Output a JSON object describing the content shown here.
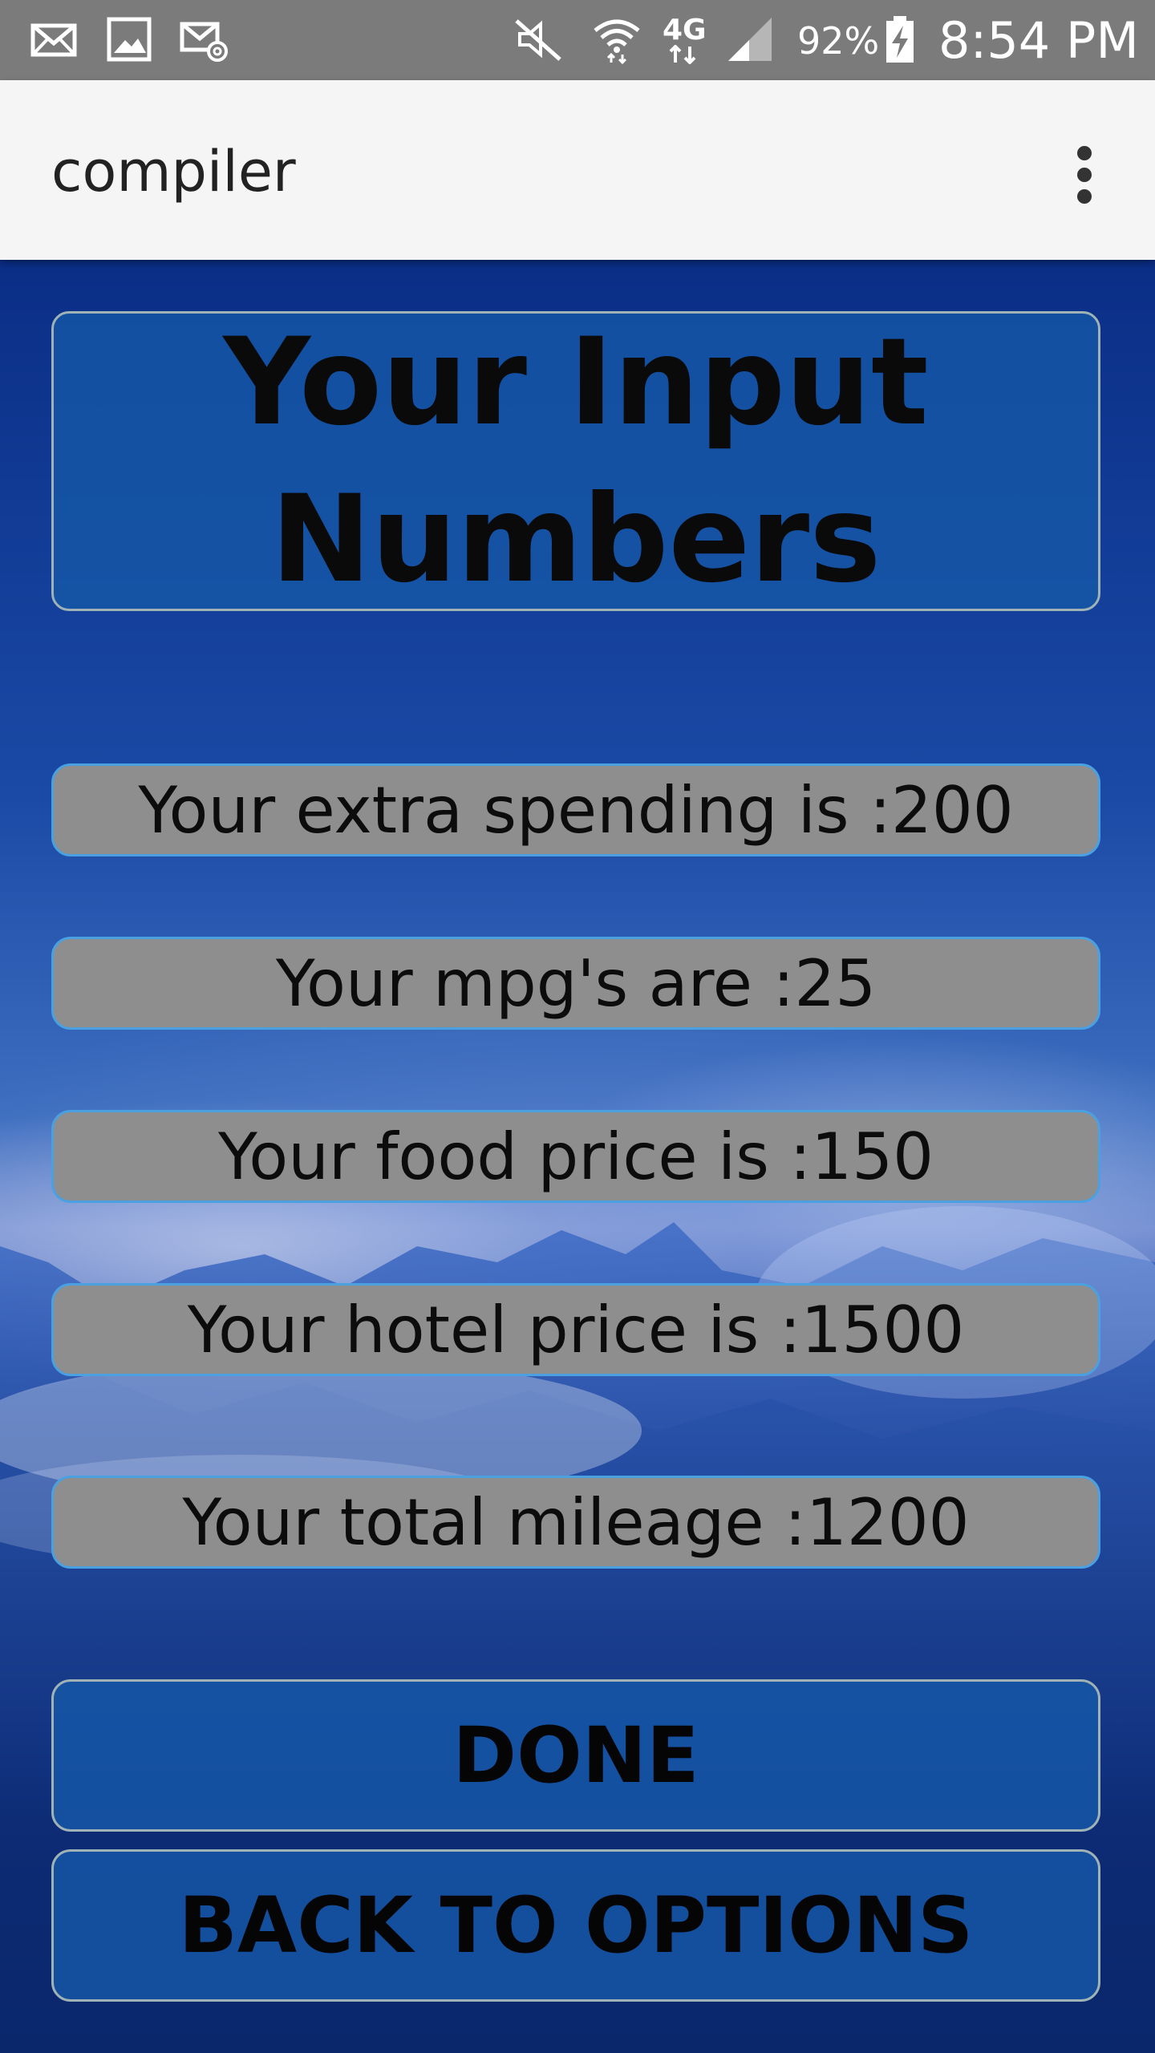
{
  "status_bar": {
    "icons": [
      "email-icon",
      "gallery-icon",
      "email-at-icon",
      "mute-icon",
      "wifi-icon",
      "4g-lte-icon",
      "signal-icon",
      "battery-charging-icon"
    ],
    "network_label": "4G",
    "battery_percent": "92%",
    "time": "8:54 PM"
  },
  "app_bar": {
    "title": "compiler",
    "menu_icon": "overflow-menu-icon"
  },
  "header": {
    "title": "Your Input Numbers"
  },
  "values": [
    {
      "label": "Your extra spending is :200"
    },
    {
      "label": "Your mpg's are :25"
    },
    {
      "label": "Your food price is :150"
    },
    {
      "label": "Your hotel price is :1500"
    },
    {
      "label": "Your total mileage :1200"
    }
  ],
  "buttons": {
    "done": "DONE",
    "back": "BACK TO OPTIONS"
  },
  "colors": {
    "status_bar": "#7b7b7b",
    "app_bar": "#f5f5f5",
    "background_blue": "#0a2e86",
    "card_blue": "#1658a8",
    "row_gray": "#8e8e8e",
    "row_border": "#4aa0e0"
  }
}
